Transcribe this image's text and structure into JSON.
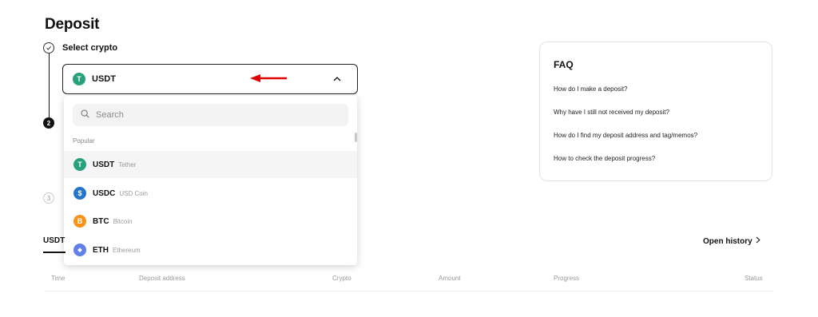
{
  "page": {
    "title": "Deposit"
  },
  "steps": [
    {
      "number": "",
      "label": "Select crypto",
      "status": "done"
    },
    {
      "number": "2",
      "status": "current"
    },
    {
      "number": "3",
      "status": "pending"
    }
  ],
  "crypto_select": {
    "selected": {
      "symbol": "USDT",
      "color": "#26a17b",
      "glyph": "T"
    },
    "expanded": true
  },
  "dropdown": {
    "search_placeholder": "Search",
    "section_label": "Popular",
    "items": [
      {
        "symbol": "USDT",
        "name": "Tether",
        "color": "#26a17b",
        "glyph": "T",
        "active": true
      },
      {
        "symbol": "USDC",
        "name": "USD Coin",
        "color": "#2775ca",
        "glyph": "$",
        "active": false
      },
      {
        "symbol": "BTC",
        "name": "Bitcoin",
        "color": "#f7931a",
        "glyph": "B",
        "active": false
      },
      {
        "symbol": "ETH",
        "name": "Ethereum",
        "color": "#627eea",
        "glyph": "◆",
        "active": false
      }
    ]
  },
  "annotations": {
    "arrow_color": "#e00000"
  },
  "faq": {
    "title": "FAQ",
    "items": [
      "How do I make a deposit?",
      "Why have I still not received my deposit?",
      "How do I find my deposit address and tag/memos?",
      "How to check the deposit progress?"
    ]
  },
  "history": {
    "tab_label": "USDT",
    "open_history_label": "Open history",
    "columns": [
      "Time",
      "Deposit address",
      "Crypto",
      "Amount",
      "Progress",
      "Status"
    ]
  }
}
